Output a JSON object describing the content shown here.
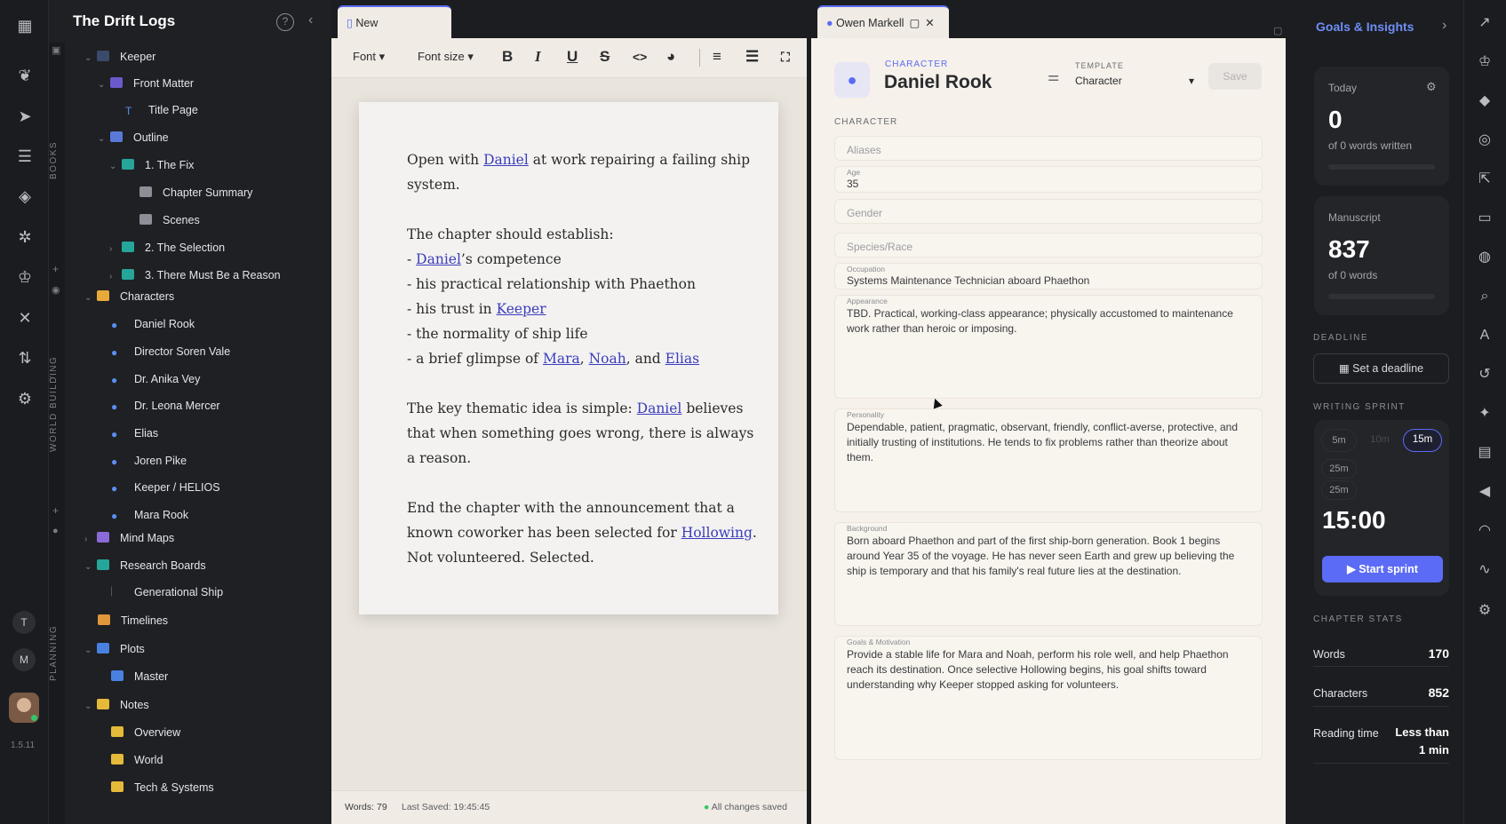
{
  "app": {
    "title": "The Drift Logs",
    "version": "1.5.11"
  },
  "sidebar": {
    "vertical_labels": [
      "BOOKS",
      "WORLD BUILDING",
      "PLANNING"
    ],
    "tree": [
      {
        "label": "Keeper"
      },
      {
        "label": "Front Matter"
      },
      {
        "label": "Title Page"
      },
      {
        "label": "Outline"
      },
      {
        "label": "1. The Fix"
      },
      {
        "label": "Chapter Summary"
      },
      {
        "label": "Scenes"
      },
      {
        "label": "2. The Selection"
      },
      {
        "label": "3. There Must Be a Reason"
      },
      {
        "label": "Characters"
      },
      {
        "label": "Daniel Rook"
      },
      {
        "label": "Director Soren Vale"
      },
      {
        "label": "Dr. Anika Vey"
      },
      {
        "label": "Dr. Leona Mercer"
      },
      {
        "label": "Elias"
      },
      {
        "label": "Joren Pike"
      },
      {
        "label": "Keeper / HELIOS"
      },
      {
        "label": "Mara Rook"
      },
      {
        "label": "Mind Maps"
      },
      {
        "label": "Research Boards"
      },
      {
        "label": "Generational Ship"
      },
      {
        "label": "Timelines"
      },
      {
        "label": "Plots"
      },
      {
        "label": "Master"
      },
      {
        "label": "Notes"
      },
      {
        "label": "Overview"
      },
      {
        "label": "World"
      },
      {
        "label": "Tech & Systems"
      }
    ],
    "avatars": [
      "T",
      "M"
    ]
  },
  "tabs": [
    {
      "label": "New Scene"
    },
    {
      "label": "Owen Markell"
    }
  ],
  "toolbar": {
    "font": "Font",
    "font_size": "Font size"
  },
  "document": {
    "p1a": "Open with ",
    "p1_link": "Daniel",
    "p1b": " at work repairing a failing ship",
    "p1c": "system.",
    "p2": "The chapter should establish:",
    "l1_pre": "- ",
    "l1_link": "Daniel",
    "l1_post": "’s competence",
    "l2": "- his practical relationship with Phaethon",
    "l3_pre": "- his trust in ",
    "l3_link": "Keeper",
    "l4": "- the normality of ship life",
    "l5_pre": "- a brief glimpse of ",
    "l5_link1": "Mara",
    "l5_sep1": ", ",
    "l5_link2": "Noah",
    "l5_sep2": ", and ",
    "l5_link3": "Elias",
    "p3a": "The key thematic idea is simple: ",
    "p3_link": "Daniel",
    "p3b": " believes",
    "p3c": "that when something goes wrong, there is always",
    "p3d": "a reason.",
    "p4a": "End the chapter with the announcement that a",
    "p4b_pre": "known coworker has been selected for ",
    "p4b_link": "Hollowing",
    "p4b_post": ".",
    "p4c": "Not volunteered. Selected."
  },
  "status": {
    "words": "Words: 79",
    "saved": "Last Saved: 19:45:45",
    "changes": "All changes saved"
  },
  "character": {
    "type_label": "CHARACTER",
    "name": "Daniel Rook",
    "template_label": "TEMPLATE",
    "template_value": "Character",
    "save": "Save",
    "section": "CHARACTER",
    "aliases_ph": "Aliases",
    "age_label": "Age",
    "age": "35",
    "gender_ph": "Gender",
    "species_ph": "Species/Race",
    "occupation_label": "Occupation",
    "occupation": "Systems Maintenance Technician aboard Phaethon",
    "appearance_label": "Appearance",
    "appearance": "TBD. Practical, working-class appearance; physically accustomed to maintenance work rather than heroic or imposing.",
    "personality_label": "Personality",
    "personality": "Dependable, patient, pragmatic, observant, friendly, conflict-averse, protective, and initially trusting of institutions. He tends to fix problems rather than theorize about them.",
    "background_label": "Background",
    "background": "Born aboard Phaethon and part of the first ship-born generation. Book 1 begins around Year 35 of the voyage. He has never seen Earth and grew up believing the ship is temporary and that his family's real future lies at the destination.",
    "goals_label": "Goals & Motivation",
    "goals": "Provide a stable life for Mara and Noah, perform his role well, and help Phaethon reach its destination. Once selective Hollowing begins, his goal shifts toward understanding why Keeper stopped asking for volunteers."
  },
  "insights": {
    "title": "Goals & Insights",
    "today_label": "Today",
    "today_value": "0",
    "today_sub": "of 0 words written",
    "progress_today": 0,
    "manuscript_label": "Manuscript",
    "manuscript_value": "837",
    "manuscript_sub": "of 0 words",
    "progress_manuscript": 0,
    "deadline_label": "DEADLINE",
    "deadline_button": "Set a deadline",
    "sprint_label": "WRITING SPRINT",
    "sprint_options": [
      "5m",
      "10m",
      "15m",
      "25m",
      "25m"
    ],
    "sprint_selected": "15m",
    "timer": "15:00",
    "start": "Start sprint",
    "stats_label": "CHAPTER STATS",
    "words_label": "Words",
    "words_value": "170",
    "chars_label": "Characters",
    "chars_value": "852",
    "reading_label": "Reading time",
    "reading_value1": "Less than",
    "reading_value2": "1 min"
  },
  "colors": {
    "accent": "#5b6bf5",
    "link": "#3b3dbb",
    "sidebar": "#1f2023",
    "paper": "#f3f2f1"
  }
}
